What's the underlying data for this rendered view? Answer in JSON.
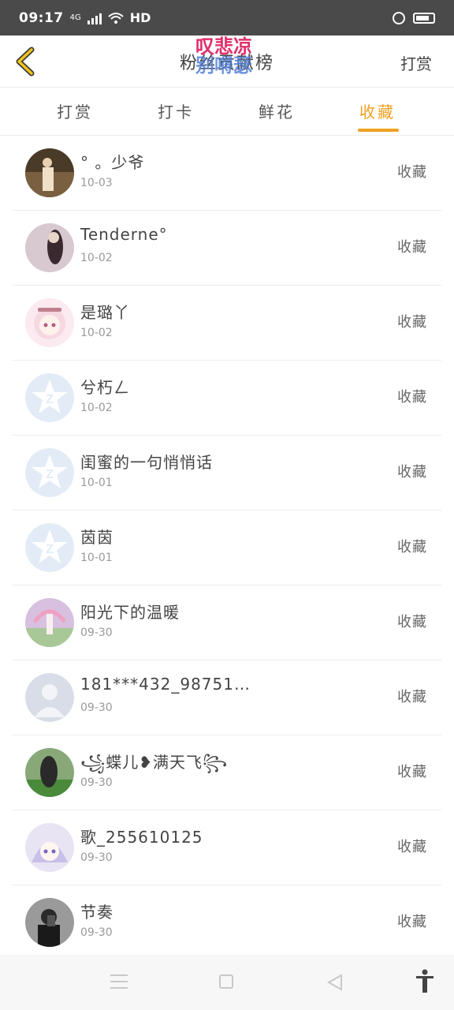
{
  "status_bar": {
    "time": "09:17",
    "network": "4G",
    "hd": "HD"
  },
  "header": {
    "title": "粉丝贡献榜",
    "right_link": "打赏",
    "watermark_top": "叹悲凉",
    "watermark_bottom": "别嘚瑟"
  },
  "tabs": [
    {
      "label": "打赏",
      "active": false
    },
    {
      "label": "打卡",
      "active": false
    },
    {
      "label": "鲜花",
      "active": false
    },
    {
      "label": "收藏",
      "active": true
    }
  ],
  "accent_color": "#f0a020",
  "list": [
    {
      "name": "° 。少爷",
      "date": "10-03",
      "action": "收藏",
      "avatar": "photo-avatar"
    },
    {
      "name": "Tenderne°",
      "date": "10-02",
      "action": "收藏",
      "avatar": "photo-avatar"
    },
    {
      "name": "是璐丫",
      "date": "10-02",
      "action": "收藏",
      "avatar": "anime-avatar"
    },
    {
      "name": "兮朽ㄥ",
      "date": "10-02",
      "action": "收藏",
      "avatar": "default-avatar"
    },
    {
      "name": "闺蜜的一句悄悄话",
      "date": "10-01",
      "action": "收藏",
      "avatar": "default-avatar"
    },
    {
      "name": "茵茵",
      "date": "10-01",
      "action": "收藏",
      "avatar": "default-avatar"
    },
    {
      "name": "阳光下的温暖",
      "date": "09-30",
      "action": "收藏",
      "avatar": "photo-avatar"
    },
    {
      "name": "181***432_98751…",
      "date": "09-30",
      "action": "收藏",
      "avatar": "blank-person-avatar"
    },
    {
      "name": "꧁蝶儿❥满天飞꧂",
      "date": "09-30",
      "action": "收藏",
      "avatar": "photo-avatar"
    },
    {
      "name": "歌_255610125",
      "date": "09-30",
      "action": "收藏",
      "avatar": "anime-avatar"
    },
    {
      "name": "节奏",
      "date": "09-30",
      "action": "收藏",
      "avatar": "photo-avatar"
    }
  ]
}
